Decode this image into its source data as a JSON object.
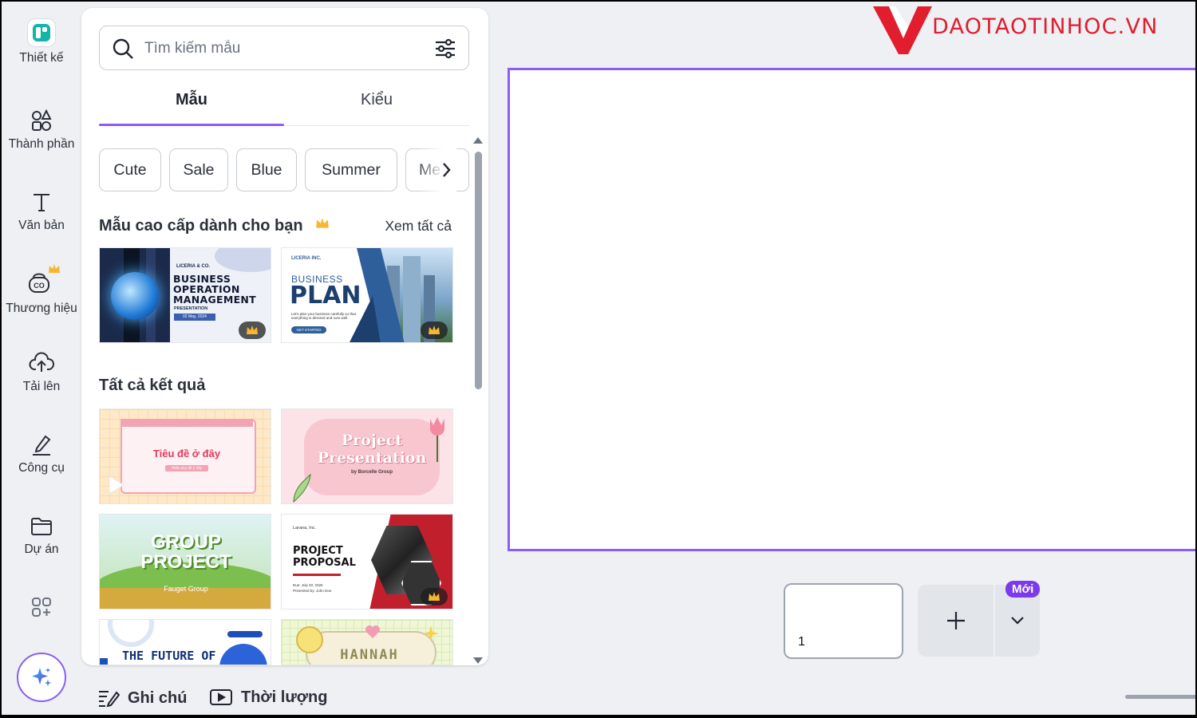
{
  "logo": {
    "text": "DAOTAOTINHOC.VN",
    "accent": "#e11d2e"
  },
  "rail": {
    "items": [
      {
        "label": "Thiết kế",
        "icon": "design-icon"
      },
      {
        "label": "Thành phần",
        "icon": "elements-icon"
      },
      {
        "label": "Văn bản",
        "icon": "text-icon"
      },
      {
        "label": "Thương hiệu",
        "icon": "brand-icon"
      },
      {
        "label": "Tải lên",
        "icon": "upload-icon"
      },
      {
        "label": "Công cụ",
        "icon": "tools-icon"
      },
      {
        "label": "Dự án",
        "icon": "folder-icon"
      },
      {
        "label": "",
        "icon": "apps-icon"
      }
    ],
    "magic_icon": "sparkle-icon"
  },
  "panel": {
    "search": {
      "placeholder": "Tìm kiếm mẫu",
      "value": ""
    },
    "tabs": [
      {
        "label": "Mẫu",
        "active": true
      },
      {
        "label": "Kiểu",
        "active": false
      }
    ],
    "chips": [
      "Cute",
      "Sale",
      "Blue",
      "Summer",
      "Me"
    ],
    "premium": {
      "title": "Mẫu cao cấp dành cho bạn",
      "see_all": "Xem tất cả",
      "templates": [
        {
          "brand": "LICERIA & CO.",
          "title": "BUSINESS OPERATION MANAGEMENT",
          "sub": "PRESENTATION",
          "date": "02 May, 2024"
        },
        {
          "brand": "LICERIA INC.",
          "title1": "BUSINESS",
          "title2": "PLAN",
          "desc": "Let's plan your business carefully so that everything is directed and runs well.",
          "cta": "GET STARTED"
        }
      ]
    },
    "all_results": {
      "title": "Tất cả kết quả",
      "templates": [
        {
          "title": "Tiêu đề ở đây",
          "sub": "Phần phụ đề ở đây"
        },
        {
          "title1": "Project",
          "title2": "Presentation",
          "sub": "by Borcelle Group"
        },
        {
          "title1": "GROUP",
          "title2": "PROJECT",
          "sub": "Fauget Group"
        },
        {
          "brand": "Larana, Inc.",
          "title1": "PROJECT",
          "title2": "PROPOSAL",
          "date": "Due: July 20, 2025",
          "presenter": "Presented by: John Doe"
        },
        {
          "title": "THE FUTURE OF"
        },
        {
          "title": "HANNAH"
        }
      ]
    }
  },
  "bottom": {
    "notes": "Ghi chú",
    "duration": "Thời lượng"
  },
  "pages": {
    "current": "1",
    "new_badge": "Mới"
  },
  "colors": {
    "accent": "#8b5cf6",
    "badge": "#7c3aed"
  }
}
